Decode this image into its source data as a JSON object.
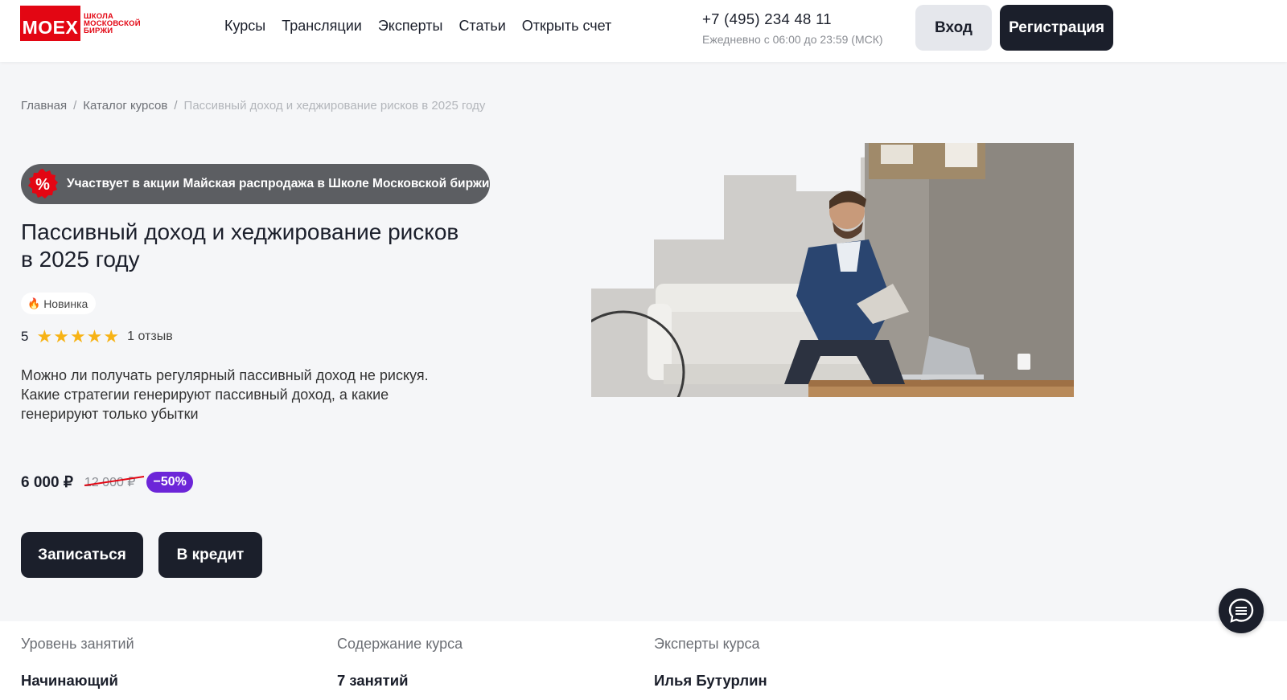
{
  "header": {
    "logo_main": "MOEX",
    "logo_sub": [
      "ШКОЛА",
      "МОСКОВСКОЙ",
      "БИРЖИ"
    ],
    "nav": [
      "Курсы",
      "Трансляции",
      "Эксперты",
      "Статьи",
      "Открыть счет"
    ],
    "phone": "+7 (495) 234 48 11",
    "hours": "Ежедневно с 06:00 до 23:59 (МСК)",
    "login_label": "Вход",
    "register_label": "Регистрация"
  },
  "breadcrumb": {
    "home": "Главная",
    "separator": "/",
    "catalog": "Каталог курсов",
    "current": "Пассивный доход и хеджирование рисков в 2025 году"
  },
  "promo": {
    "badge_symbol": "%",
    "text": "Участвует в акции Майская распродажа в Школе Московской биржи"
  },
  "course": {
    "title": "Пассивный доход и хеджирование рисков в 2025 году",
    "tag_icon": "🔥",
    "tag": "Новинка",
    "rating": "5",
    "stars_count": 5,
    "reviews": "1 отзыв",
    "description": "Можно ли получать регулярный пассивный доход не рискуя. Какие стратегии генерируют пассивный доход, а какие генерируют только убытки",
    "price": "6 000 ₽",
    "old_price": "12 000 ₽",
    "discount": "−50%",
    "enroll_label": "Записаться",
    "credit_label": "В кредит"
  },
  "info": {
    "level_label": "Уровень занятий",
    "level_value": "Начинающий",
    "content_label": "Содержание курса",
    "content_value": "7 занятий",
    "experts_label": "Эксперты курса",
    "experts_value": "Илья Бутурлин"
  },
  "colors": {
    "brand_red": "#e30613",
    "dark": "#1b1f2b",
    "discount_purple": "#6c25d8",
    "star": "#f7b315",
    "promo_gray": "#5c5e62"
  }
}
